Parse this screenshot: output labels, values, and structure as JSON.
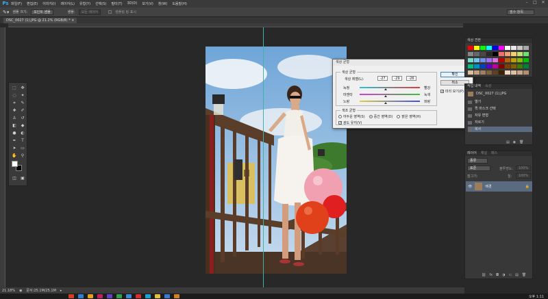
{
  "menubar": {
    "logo": "Ps",
    "items": [
      "파일(F)",
      "편집(E)",
      "이미지(I)",
      "레이어(L)",
      "유형(Y)",
      "선택(S)",
      "필터(T)",
      "3D(D)",
      "보기(V)",
      "창(W)",
      "도움말(H)"
    ]
  },
  "options": {
    "sample_label": "샘플 크기:",
    "sample_value": "포인트 샘플",
    "sample2_label": "샘플:",
    "sample2_value": "모든 레이어",
    "ring_label": "샘플링 링 표시",
    "workspace": "필수 항목"
  },
  "document": {
    "tab_label": "DSC_0027 (1).JPG @ 21.2% (RGB/8) * ×",
    "zoom": "21.18%",
    "doc_info": "문서:25.1M/25.1M"
  },
  "dialog": {
    "title": "색상 균형",
    "group1_title": "색상 균형",
    "levels_label": "색상 레벨(L):",
    "levels": [
      "-27",
      "-29",
      "-26"
    ],
    "sliders": [
      {
        "left": "녹청",
        "right": "빨강",
        "pos": 0.43,
        "color_left": "#22c4d6",
        "color_right": "#e33b3b"
      },
      {
        "left": "마젠타",
        "right": "녹색",
        "pos": 0.43,
        "color_left": "#d63ad6",
        "color_right": "#3bbf3b"
      },
      {
        "left": "노랑",
        "right": "파랑",
        "pos": 0.43,
        "color_left": "#e0d23a",
        "color_right": "#3b4fe0"
      }
    ],
    "group2_title": "색조 균형",
    "tones": [
      "어두운 영역(S)",
      "중간 영역(D)",
      "밝은 영역(H)"
    ],
    "tone_selected": 1,
    "preserve_label": "광도 유지(V)",
    "ok_label": "확인",
    "cancel_label": "취소",
    "preview_label": "미리 보기(P)"
  },
  "panels": {
    "swatches_tab": "색상 견본",
    "history_tabs": [
      "작업 내역",
      "속성"
    ],
    "history_file": "DSC_0027 (1).JPG",
    "history_items": [
      "열기",
      "퀵 마스크 선택",
      "자유 변형",
      "자르기",
      "복사"
    ],
    "layers_tabs": [
      "레이어",
      "채널",
      "패스"
    ],
    "layer_kind": "종류",
    "blend_mode": "표준",
    "opacity_label": "불투명도:",
    "opacity": "100%",
    "lock_label": "잠그기:",
    "fill_label": "칠:",
    "fill": "100%",
    "layer_name": "배경"
  },
  "taskbar": {
    "clock": "오후 1:11"
  }
}
